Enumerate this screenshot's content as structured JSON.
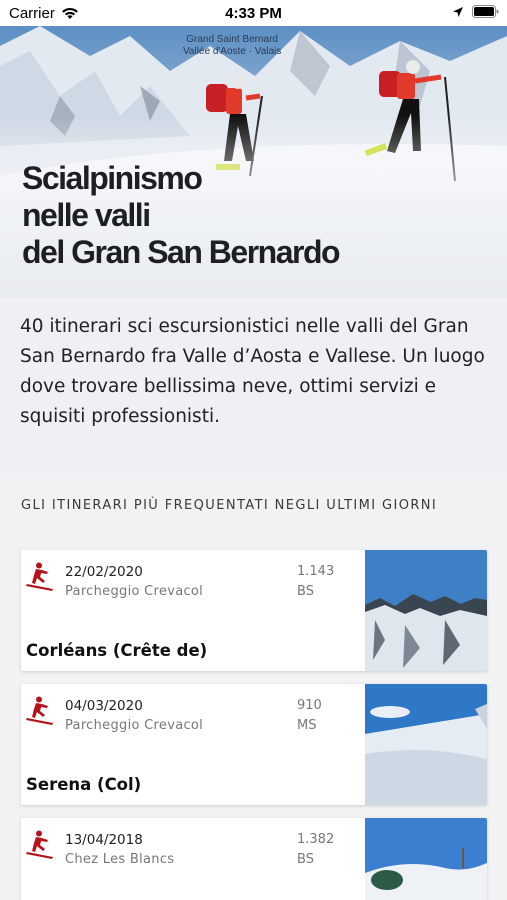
{
  "status_bar": {
    "carrier": "Carrier",
    "time": "4:33 PM"
  },
  "hero": {
    "logo_line1": "Grand Saint Bernard",
    "logo_line2": "Vallée d'Aoste · Valais",
    "title_lines": [
      "Scialpinismo",
      "nelle valli",
      "del Gran San Bernardo"
    ]
  },
  "description": "40 itinerari sci escursionistici nelle valli del Gran San Bernardo fra Valle d’Aosta e Vallese. Un luogo dove trovare bellissima neve, ottimi servizi e squisiti professionisti.",
  "section": {
    "title": "GLI ITINERARI PIÙ FREQUENTATI NEGLI ULTIMI GIORNI"
  },
  "itineraries": [
    {
      "date": "22/02/2020",
      "place": "Parcheggio Crevacol",
      "elevation": "1.143",
      "difficulty": "BS",
      "name": "Corléans (Crête de)"
    },
    {
      "date": "04/03/2020",
      "place": "Parcheggio Crevacol",
      "elevation": "910",
      "difficulty": "MS",
      "name": "Serena (Col)"
    },
    {
      "date": "13/04/2018",
      "place": "Chez Les Blancs",
      "elevation": "1.382",
      "difficulty": "BS",
      "name": ""
    }
  ],
  "icons": {
    "skier": "skier-icon",
    "wifi": "wifi-icon",
    "location": "location-arrow-icon",
    "battery": "battery-icon"
  },
  "colors": {
    "accent_red": "#b5121b",
    "background": "#efeff4"
  }
}
